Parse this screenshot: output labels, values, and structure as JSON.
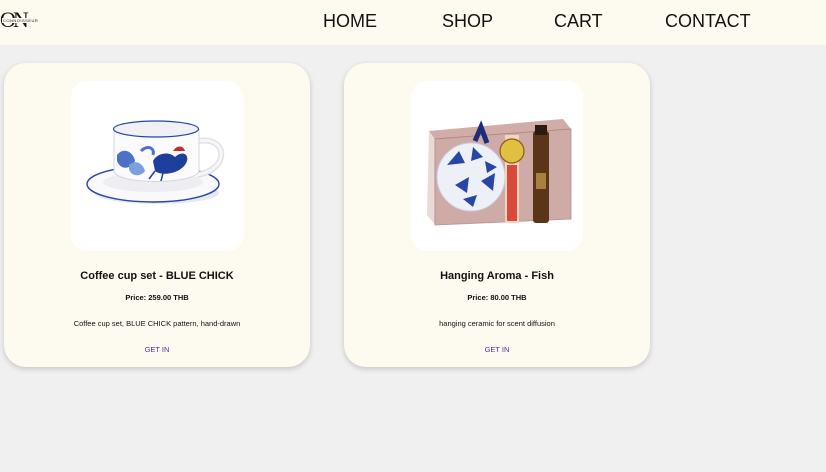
{
  "header": {
    "logo_text": "ON",
    "logo_wordmark": "CONNOISSEUR",
    "nav": {
      "home": "HOME",
      "shop": "SHOP",
      "cart": "CART",
      "contact": "CONTACT"
    }
  },
  "products": [
    {
      "title": "Coffee cup set - BLUE CHICK",
      "price": "Price: 259.00 THB",
      "description": "Coffee cup set, BLUE CHICK pattern, hand-drawn",
      "link": "GET IN",
      "image": "coffee-cup-image"
    },
    {
      "title": "Hanging Aroma - Fish",
      "price": "Price: 80.00 THB",
      "description": "hanging ceramic for scent diffusion",
      "link": "GET IN",
      "image": "hanging-aroma-image"
    }
  ],
  "colors": {
    "page_bg": "#f0f0f0",
    "header_bg": "#fdfaf0",
    "card_bg": "#fdfaf0",
    "link": "#5b2aa6",
    "porcelain_blue": "#1f3f9e"
  }
}
